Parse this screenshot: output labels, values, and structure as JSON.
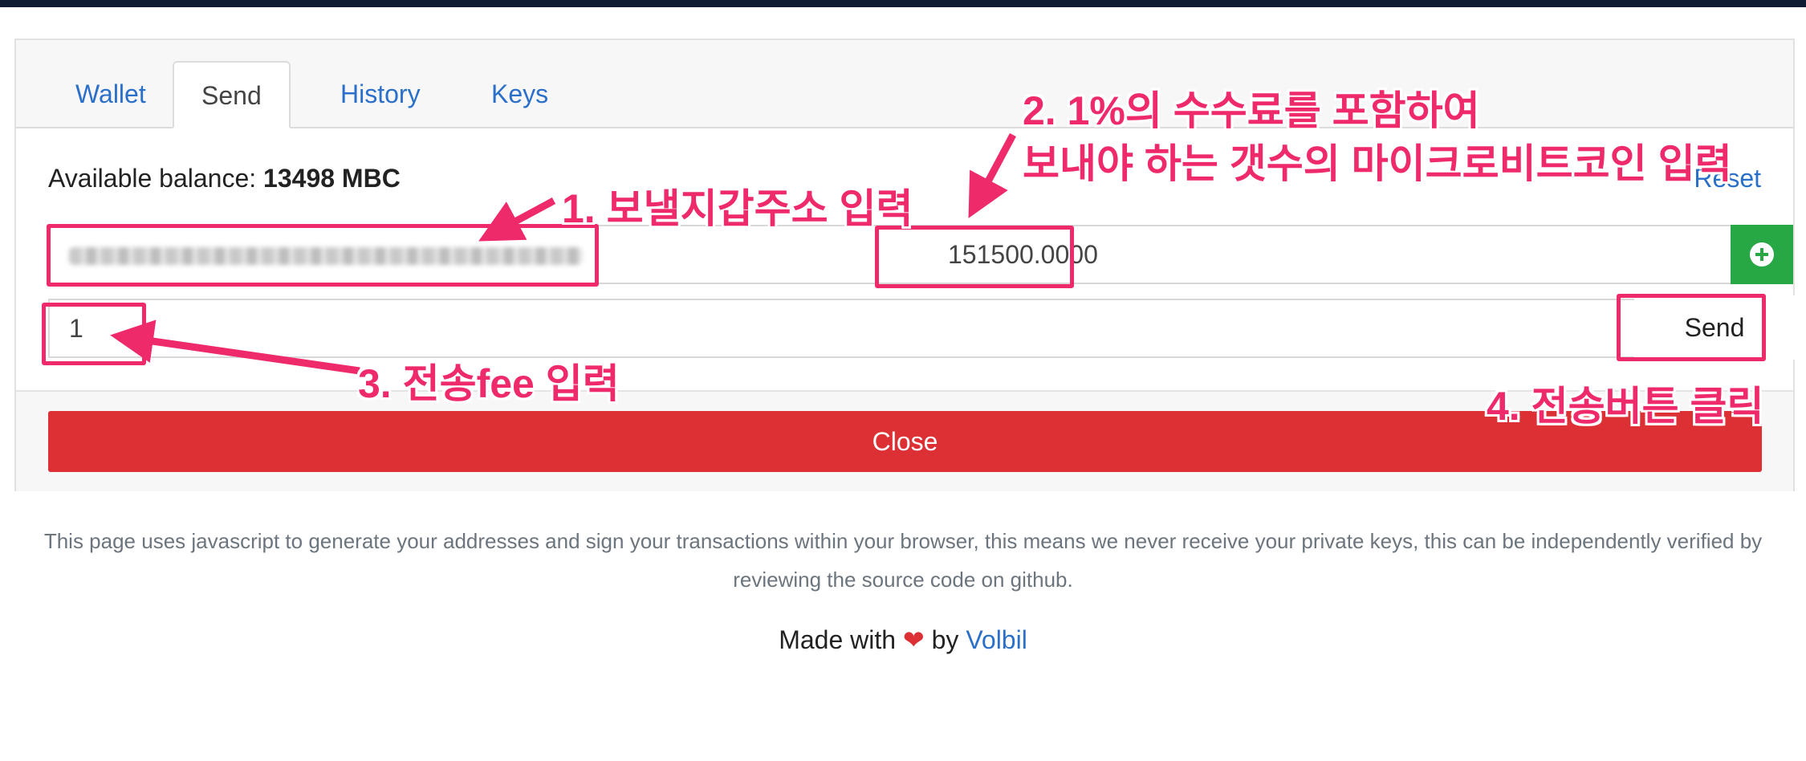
{
  "tabs": [
    {
      "label": "Wallet"
    },
    {
      "label": "Send"
    },
    {
      "label": "History"
    },
    {
      "label": "Keys"
    }
  ],
  "balance": {
    "label": "Available balance:",
    "value": "13498 MBC"
  },
  "reset_label": "Reset",
  "form": {
    "amount_value": "151500.0000",
    "fee_value": "1",
    "send_label": "Send",
    "close_label": "Close"
  },
  "footer": {
    "info_text": "This page uses javascript to generate your addresses and sign your transactions within your browser, this means we never receive your private keys, this can be independently verified by reviewing the source code on github.",
    "made_prefix": "Made with",
    "made_by": "by",
    "made_link": "Volbil"
  },
  "annotations": {
    "step1": "1. 보낼지갑주소 입력",
    "step2_line1": "2. 1%의 수수료를 포함하여",
    "step2_line2": "보내야 하는 갯수의 마이크로비트코인 입력",
    "step3": "3. 전송fee 입력",
    "step4": "4. 전송버튼 클릭",
    "color": "#ee2a6b"
  },
  "icons": {
    "add": "plus-circle-icon",
    "heart": "heart-icon"
  },
  "colors": {
    "primary_link": "#2a6fc9",
    "success": "#28a745",
    "danger": "#dc3035",
    "topbar": "#0f1b33"
  }
}
